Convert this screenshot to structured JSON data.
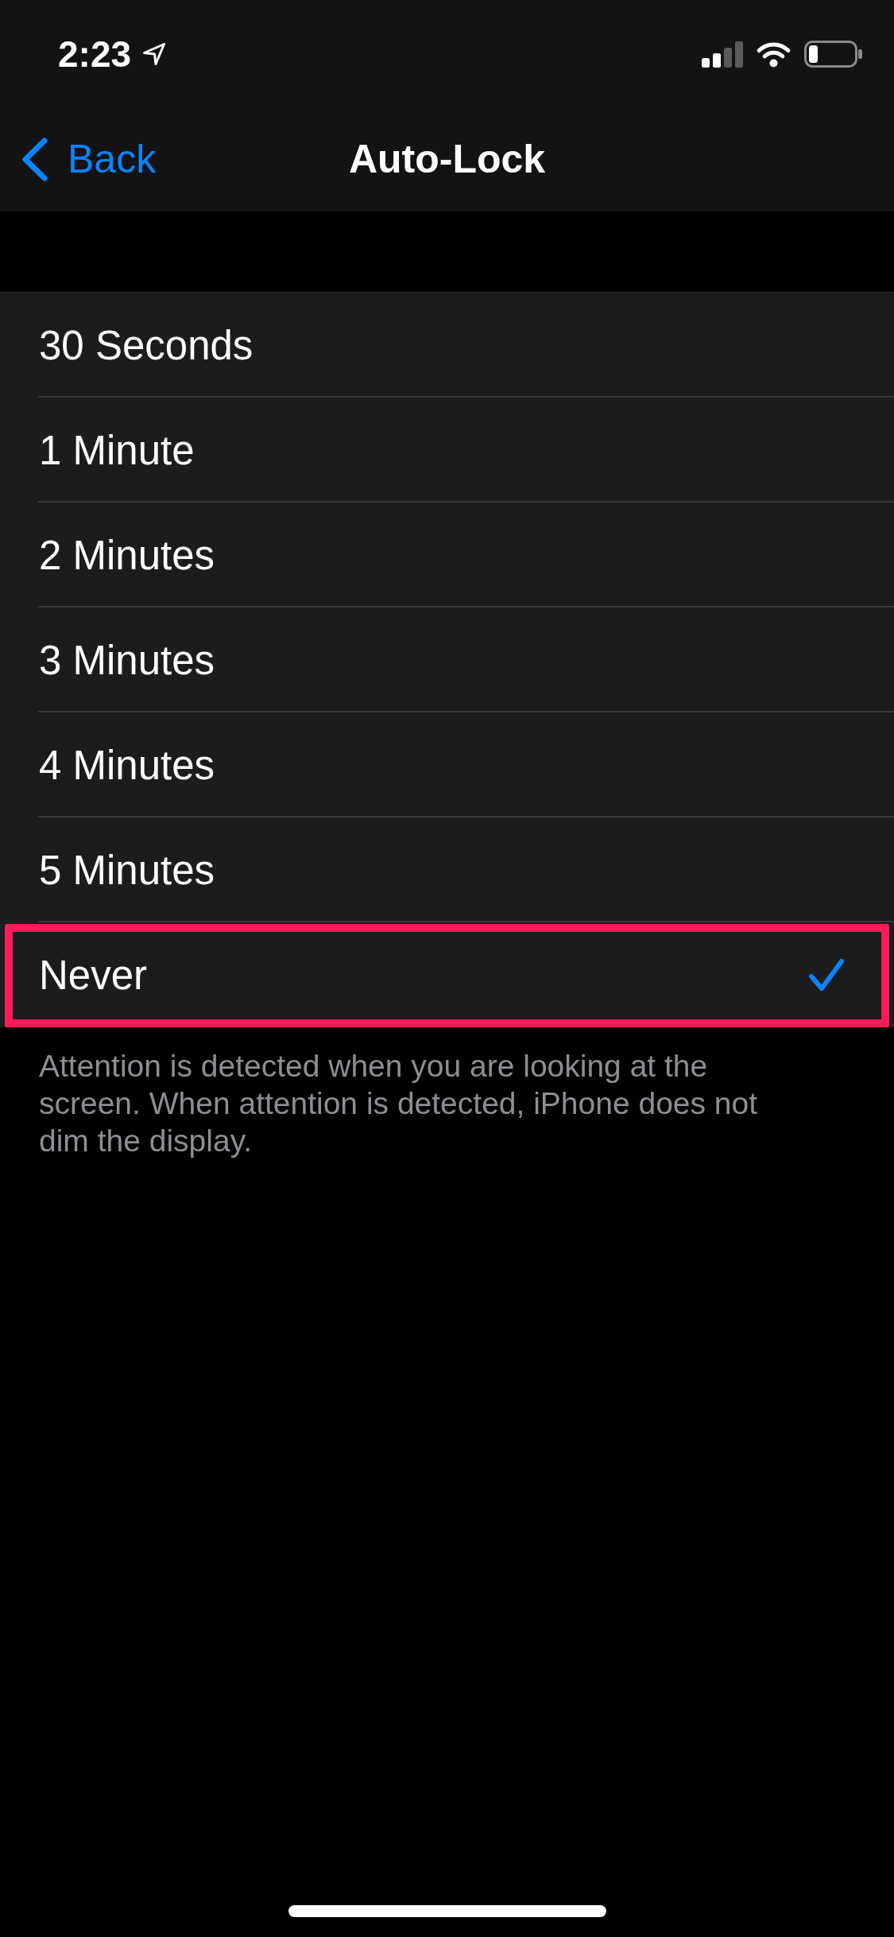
{
  "status_bar": {
    "time": "2:23"
  },
  "nav_bar": {
    "back": "Back",
    "title": "Auto-Lock"
  },
  "options": [
    {
      "label": "30 Seconds",
      "selected": false,
      "highlighted": false
    },
    {
      "label": "1 Minute",
      "selected": false,
      "highlighted": false
    },
    {
      "label": "2 Minutes",
      "selected": false,
      "highlighted": false
    },
    {
      "label": "3 Minutes",
      "selected": false,
      "highlighted": false
    },
    {
      "label": "4 Minutes",
      "selected": false,
      "highlighted": false
    },
    {
      "label": "5 Minutes",
      "selected": false,
      "highlighted": false
    },
    {
      "label": "Never",
      "selected": true,
      "highlighted": true
    }
  ],
  "footer": "Attention is detected when you are looking at the screen. When attention is detected, iPhone does not dim the display."
}
